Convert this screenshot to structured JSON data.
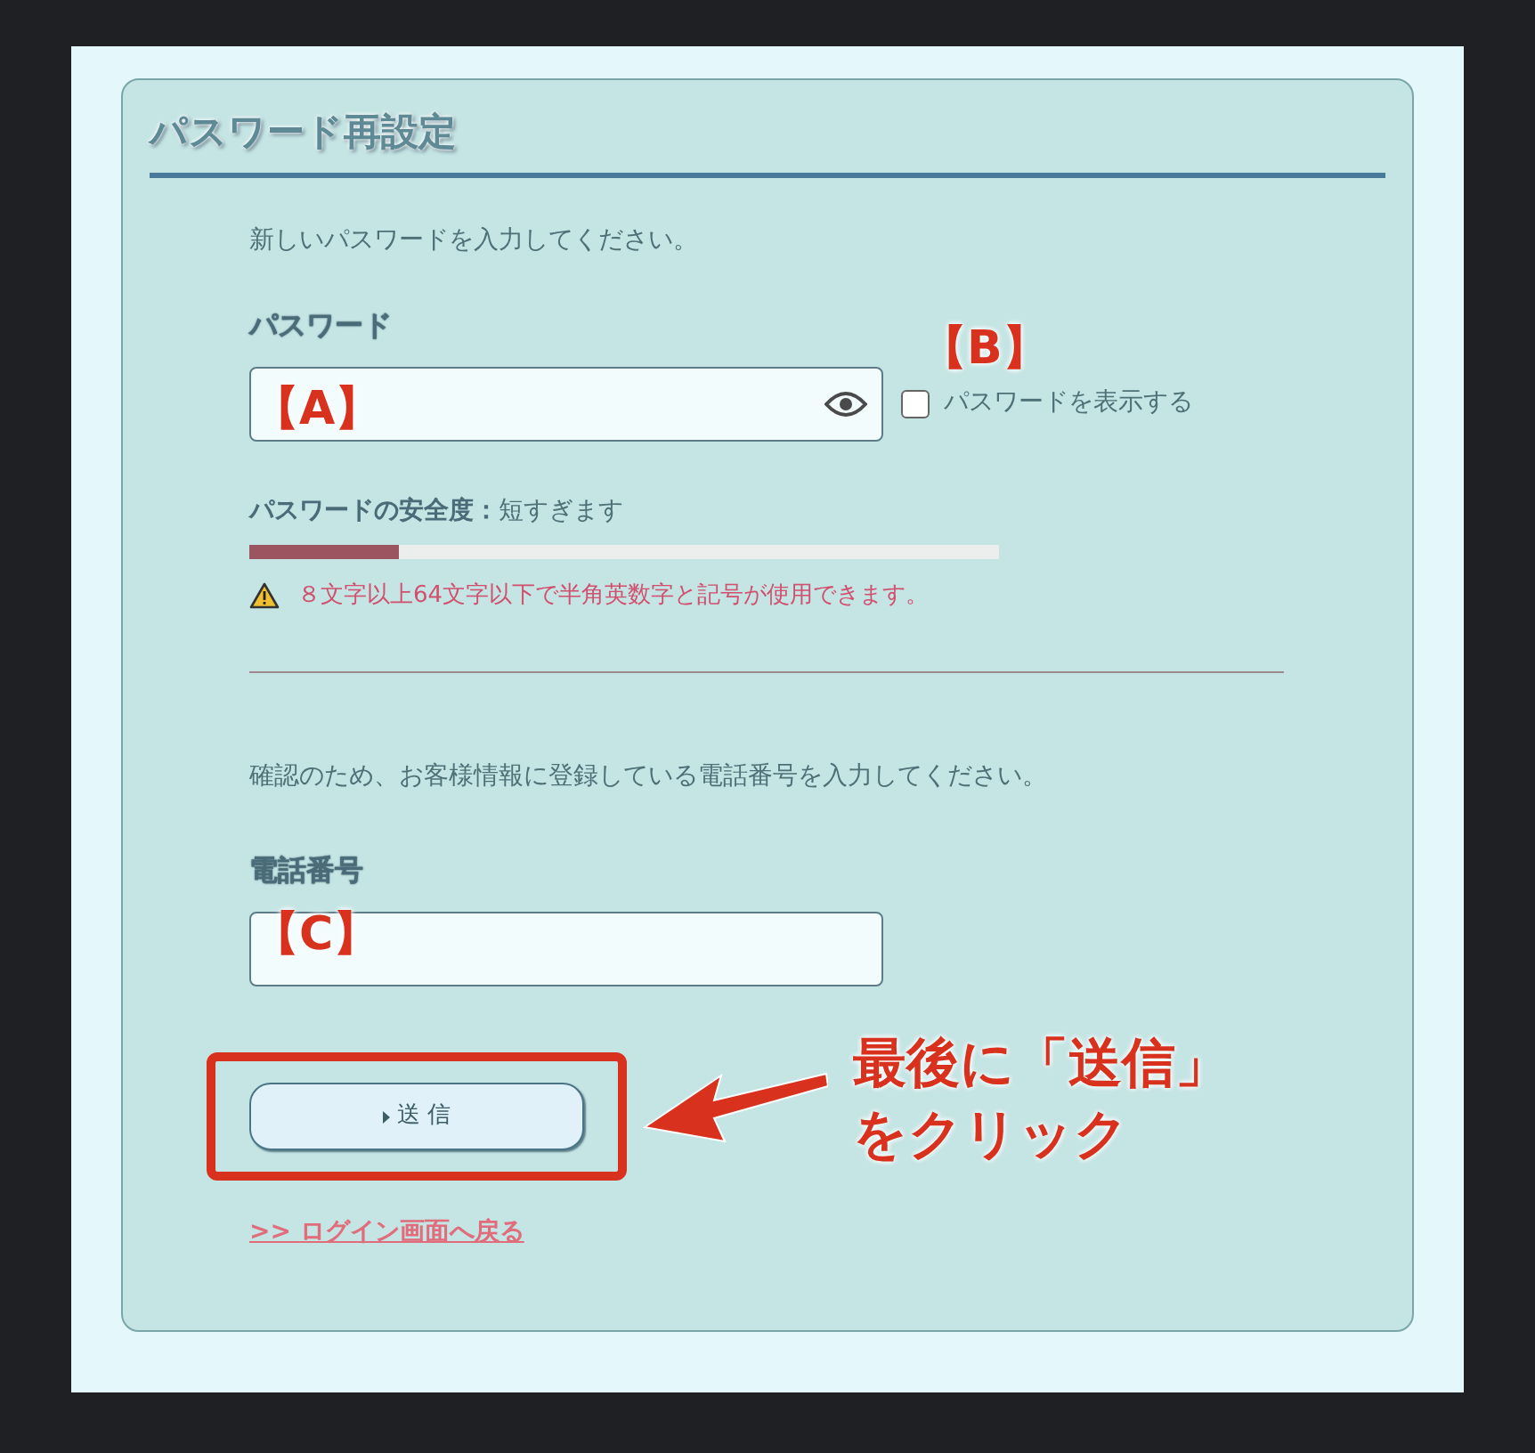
{
  "title": "パスワード再設定",
  "password_section": {
    "instruction": "新しいパスワードを入力してください。",
    "label": "パスワード",
    "field_annotation": "【A】",
    "show_password": {
      "label": "パスワードを表示する",
      "checked": false,
      "annotation": "【B】"
    },
    "strength": {
      "label": "パスワードの安全度：",
      "value": "短すぎます",
      "level": 0.2
    },
    "warning": "８文字以上64文字以下で半角英数字と記号が使用できます。"
  },
  "phone_section": {
    "instruction": "確認のため、お客様情報に登録している電話番号を入力してください。",
    "label": "電話番号",
    "field_annotation": "【C】"
  },
  "submit_button": "送 信",
  "callout": [
    "最後に「送信」",
    "をクリック"
  ],
  "back_link": ">>  ログイン画面へ戻る"
}
